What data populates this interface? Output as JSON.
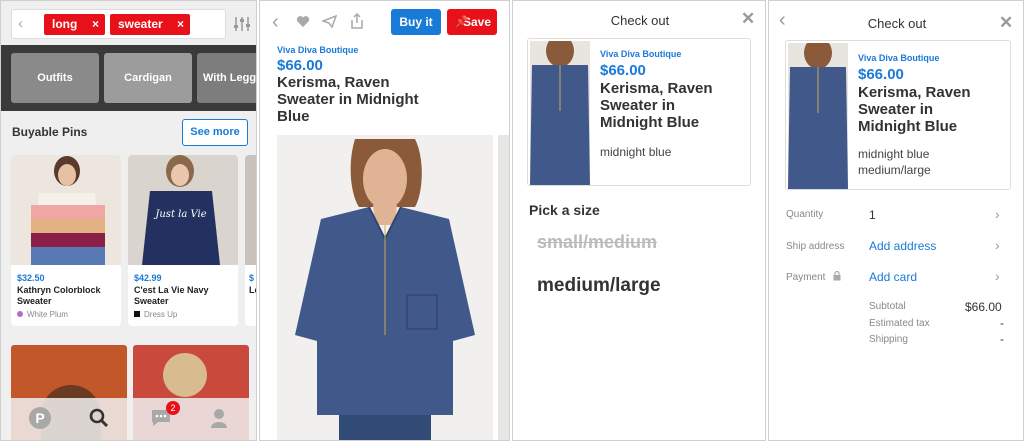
{
  "screen1": {
    "tags": [
      {
        "label": "long",
        "remove": "×"
      },
      {
        "label": "sweater",
        "remove": "×"
      }
    ],
    "categories": [
      "Outfits",
      "Cardigan",
      "With Legg"
    ],
    "section_title": "Buyable Pins",
    "see_more": "See more",
    "pins": [
      {
        "price": "$32.50",
        "title": "Kathryn Colorblock Sweater",
        "source": "White Plum"
      },
      {
        "price": "$42.99",
        "title": "C'est La Vie Navy Sweater",
        "source": "Dress Up"
      },
      {
        "price": "$",
        "title": "Lc"
      }
    ],
    "tabbar": {
      "badge": "2"
    },
    "sweater_text": "Just la Vie"
  },
  "screen2": {
    "buy_label": "Buy it",
    "save_label": "Save",
    "store": "Viva Diva Boutique",
    "price": "$66.00",
    "title": "Kerisma, Raven Sweater in Midnight Blue"
  },
  "screen3": {
    "header": "Check out",
    "store": "Viva Diva Boutique",
    "price": "$66.00",
    "title": "Kerisma, Raven Sweater in Midnight Blue",
    "color": "midnight blue",
    "size_prompt": "Pick a size",
    "sizes": [
      {
        "label": "small/medium",
        "available": false
      },
      {
        "label": "medium/large",
        "available": true
      }
    ]
  },
  "screen4": {
    "header": "Check out",
    "store": "Viva Diva Boutique",
    "price": "$66.00",
    "title": "Kerisma, Raven Sweater in Midnight Blue",
    "color": "midnight blue",
    "size": "medium/large",
    "quantity_label": "Quantity",
    "quantity_value": "1",
    "ship_label": "Ship address",
    "ship_value": "Add address",
    "payment_label": "Payment",
    "payment_value": "Add card",
    "subtotal_label": "Subtotal",
    "subtotal_value": "$66.00",
    "tax_label": "Estimated tax",
    "tax_value": "-",
    "shipping_label": "Shipping",
    "shipping_value": "-"
  },
  "colors": {
    "red": "#e8111a",
    "blue": "#1a7ad8",
    "navy": "#3f5683"
  }
}
